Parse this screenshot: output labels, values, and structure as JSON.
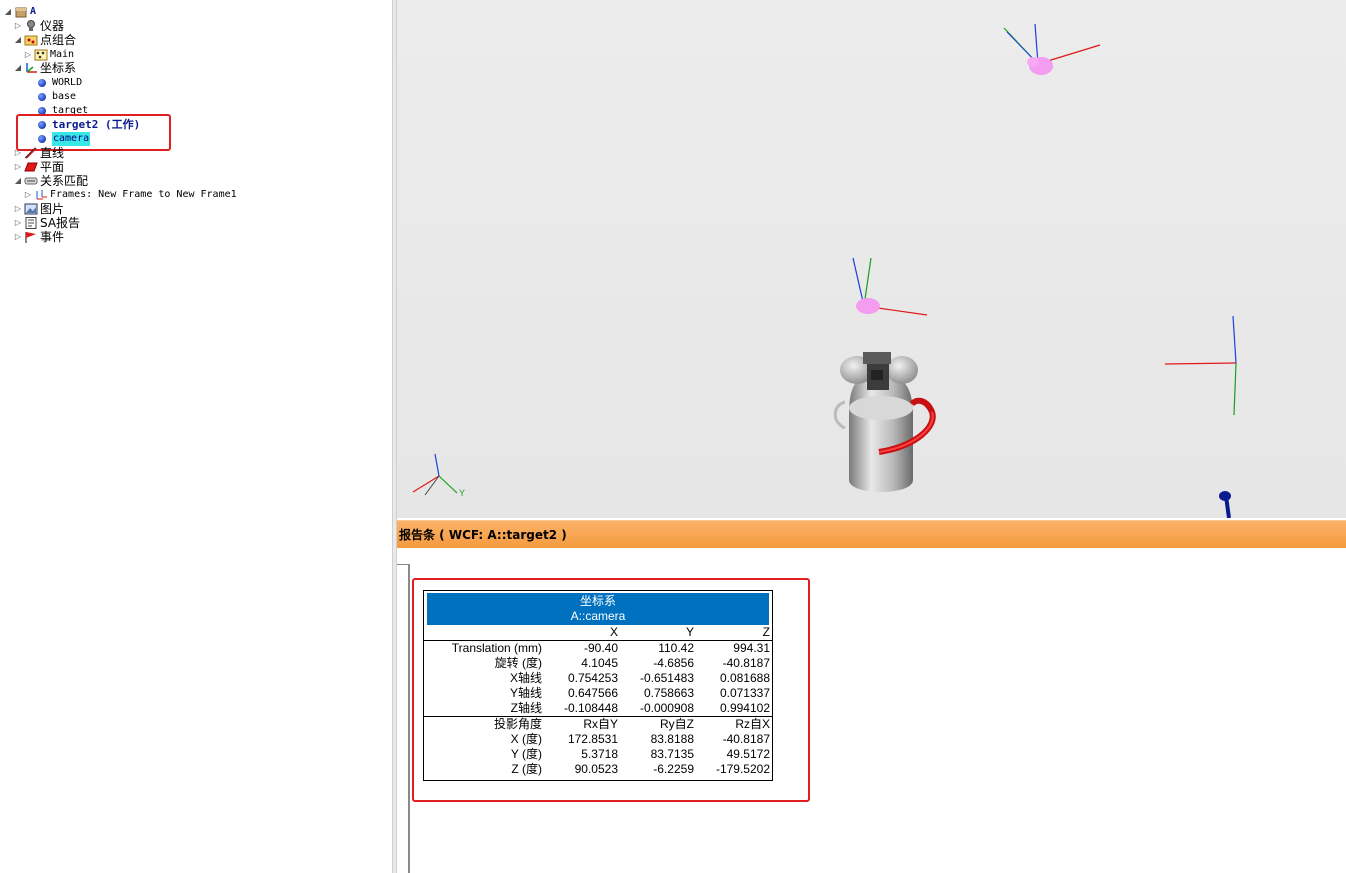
{
  "tree": {
    "root": "A",
    "instrument": "仪器",
    "point_groups": "点组合",
    "main": "Main",
    "frames_folder": "坐标系",
    "frames": [
      {
        "label": "WORLD"
      },
      {
        "label": "base"
      },
      {
        "label": "target"
      },
      {
        "label": "target2 (工作)"
      },
      {
        "label": "camera"
      }
    ],
    "lines": "直线",
    "planes": "平面",
    "relationships": "关系匹配",
    "relationship_item": "Frames: New Frame to New Frame1",
    "pictures": "图片",
    "sa_report": "SA报告",
    "events": "事件"
  },
  "viewport": {
    "triad_y_label": "Y"
  },
  "report_bar": {
    "title": "报告条 ( WCF: A::target2 )"
  },
  "report_table": {
    "title": "坐标系",
    "subtitle": "A::camera",
    "col_headers": [
      "",
      "X",
      "Y",
      "Z"
    ],
    "rows": [
      [
        "Translation (mm)",
        "-90.40",
        "110.42",
        "994.31"
      ],
      [
        "旋转 (度)",
        "4.1045",
        "-4.6856",
        "-40.8187"
      ],
      [
        "X轴线",
        "0.754253",
        "-0.651483",
        "0.081688"
      ],
      [
        "Y轴线",
        "0.647566",
        "0.758663",
        "0.071337"
      ],
      [
        "Z轴线",
        "-0.108448",
        "-0.000908",
        "0.994102"
      ]
    ],
    "proj_headers": [
      "投影角度",
      "Rx自Y",
      "Ry自Z",
      "Rz自X"
    ],
    "proj_rows": [
      [
        "X (度)",
        "172.8531",
        "83.8188",
        "-40.8187"
      ],
      [
        "Y (度)",
        "5.3718",
        "83.7135",
        "49.5172"
      ],
      [
        "Z (度)",
        "90.0523",
        "-6.2259",
        "-179.5202"
      ]
    ]
  },
  "colors": {
    "report_bar": "#f49a3e",
    "table_header": "#0071bf",
    "highlight": "#39e8e6",
    "annotation_box": "#e02020"
  }
}
